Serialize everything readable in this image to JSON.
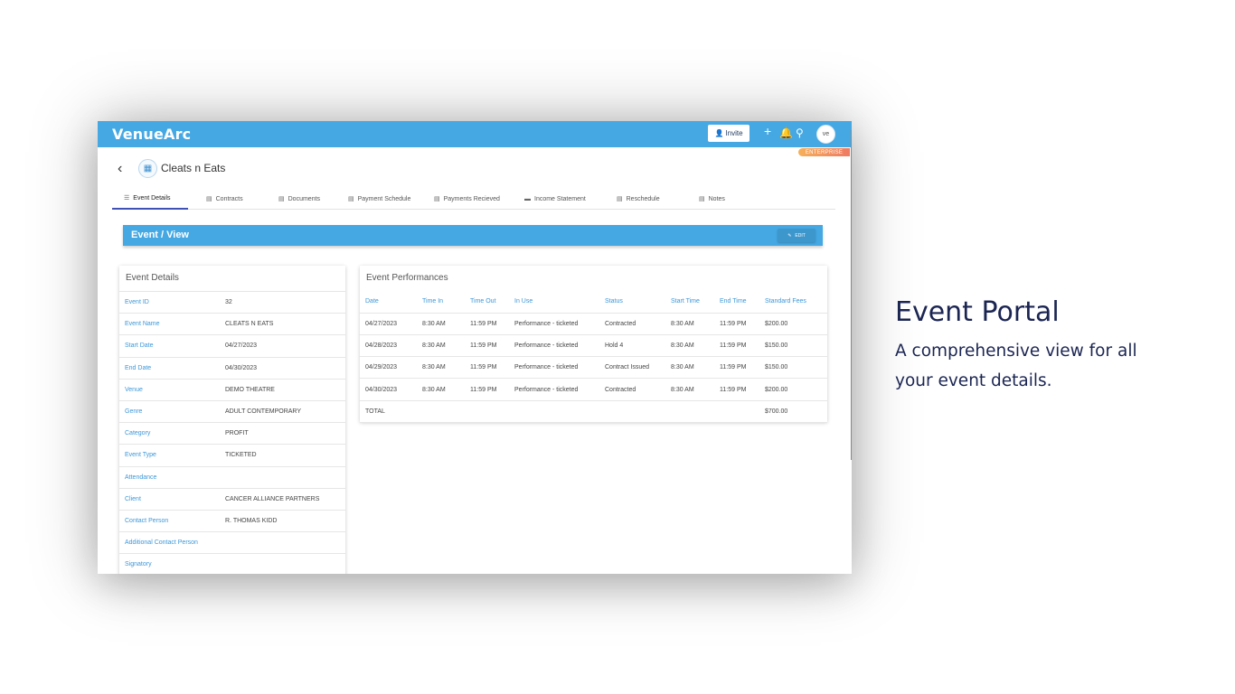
{
  "app": {
    "logo": "VenueArc",
    "invite_label": "Invite",
    "avatar_initials": "ve",
    "plan_badge": "ENTERPRISE",
    "accent_color": "#45a8e3"
  },
  "event": {
    "name": "Cleats n Eats"
  },
  "tabs": [
    {
      "label": "Event Details",
      "icon": "list-icon",
      "active": true
    },
    {
      "label": "Contracts",
      "icon": "file-icon"
    },
    {
      "label": "Documents",
      "icon": "file-icon"
    },
    {
      "label": "Payment Schedule",
      "icon": "clipboard-icon"
    },
    {
      "label": "Payments Recieved",
      "icon": "bar-chart-icon"
    },
    {
      "label": "Income Statement",
      "icon": "handshake-icon"
    },
    {
      "label": "Reschedule",
      "icon": "file-icon"
    },
    {
      "label": "Notes",
      "icon": "note-icon"
    }
  ],
  "header_bar": {
    "title": "Event / View",
    "edit_label": "EDIT"
  },
  "details": {
    "title": "Event Details",
    "rows": [
      {
        "label": "Event ID",
        "value": "32"
      },
      {
        "label": "Event Name",
        "value": "CLEATS N EATS"
      },
      {
        "label": "Start Date",
        "value": "04/27/2023"
      },
      {
        "label": "End Date",
        "value": "04/30/2023"
      },
      {
        "label": "Venue",
        "value": "DEMO THEATRE"
      },
      {
        "label": "Genre",
        "value": "ADULT CONTEMPORARY"
      },
      {
        "label": "Category",
        "value": "PROFIT"
      },
      {
        "label": "Event Type",
        "value": "TICKETED"
      },
      {
        "label": "Attendance",
        "value": ""
      },
      {
        "label": "Client",
        "value": "CANCER ALLIANCE PARTNERS"
      },
      {
        "label": "Contact Person",
        "value": "R. THOMAS KIDD"
      },
      {
        "label": "Additional Contact Person",
        "value": ""
      },
      {
        "label": "Signatory",
        "value": ""
      }
    ]
  },
  "performances": {
    "title": "Event Performances",
    "columns": [
      "Date",
      "Time In",
      "Time Out",
      "In Use",
      "Status",
      "Start Time",
      "End Time",
      "Standard Fees"
    ],
    "rows": [
      [
        "04/27/2023",
        "8:30 AM",
        "11:59 PM",
        "Performance - ticketed",
        "Contracted",
        "8:30 AM",
        "11:59 PM",
        "$200.00"
      ],
      [
        "04/28/2023",
        "8:30 AM",
        "11:59 PM",
        "Performance - ticketed",
        "Hold 4",
        "8:30 AM",
        "11:59 PM",
        "$150.00"
      ],
      [
        "04/29/2023",
        "8:30 AM",
        "11:59 PM",
        "Performance - ticketed",
        "Contract Issued",
        "8:30 AM",
        "11:59 PM",
        "$150.00"
      ],
      [
        "04/30/2023",
        "8:30 AM",
        "11:59 PM",
        "Performance - ticketed",
        "Contracted",
        "8:30 AM",
        "11:59 PM",
        "$200.00"
      ]
    ],
    "total_label": "TOTAL",
    "total_value": "$700.00"
  },
  "promo": {
    "title": "Event Portal",
    "subtitle": "A comprehensive view for all your event details."
  }
}
